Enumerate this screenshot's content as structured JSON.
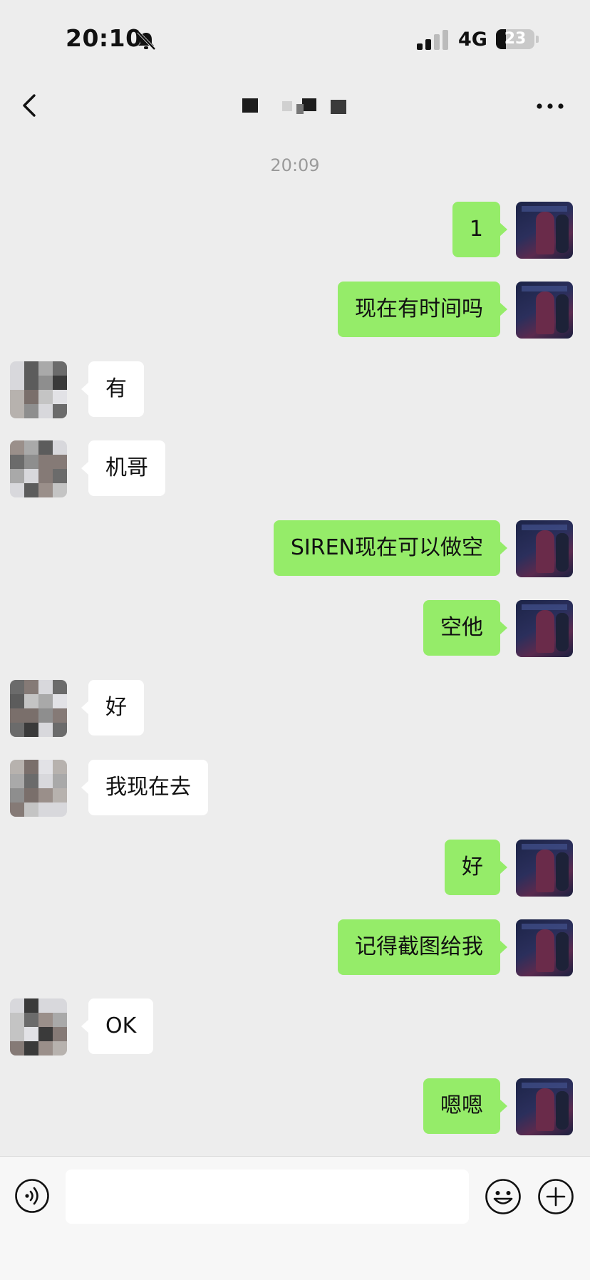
{
  "status_bar": {
    "time": "20:10",
    "network": "4G",
    "battery": "23",
    "icons": [
      "bell-slash-icon",
      "signal-icon",
      "battery-icon"
    ]
  },
  "nav": {
    "title": "",
    "back_icon": "chevron-left-icon",
    "more_icon": "more-dots-icon"
  },
  "timestamp": "20:09",
  "messages": [
    {
      "side": "out",
      "text": "1"
    },
    {
      "side": "out",
      "text": "现在有时间吗"
    },
    {
      "side": "in",
      "text": "有"
    },
    {
      "side": "in",
      "text": "机哥"
    },
    {
      "side": "out",
      "text": "SIREN现在可以做空"
    },
    {
      "side": "out",
      "text": "空他"
    },
    {
      "side": "in",
      "text": "好"
    },
    {
      "side": "in",
      "text": "我现在去"
    },
    {
      "side": "out",
      "text": "好"
    },
    {
      "side": "out",
      "text": "记得截图给我"
    },
    {
      "side": "in",
      "text": "OK"
    },
    {
      "side": "out",
      "text": "嗯嗯"
    }
  ],
  "input_bar": {
    "placeholder": "",
    "icons": [
      "voice-icon",
      "emoji-icon",
      "plus-icon"
    ]
  },
  "colors": {
    "background": "#ededed",
    "outgoing_bubble": "#95ec69",
    "incoming_bubble": "#ffffff",
    "timestamp": "#9a9a9a"
  }
}
